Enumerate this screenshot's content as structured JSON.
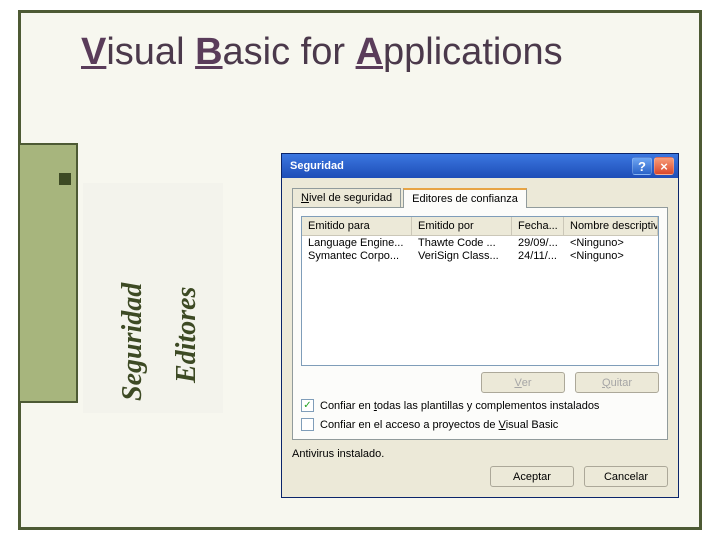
{
  "slide_title": {
    "v": "V",
    "visual_rest": "isual ",
    "b": "B",
    "basic_rest": "asic for ",
    "a": "A",
    "app_rest": "pplications"
  },
  "labels": {
    "seguridad": "Seguridad",
    "editores": "Editores"
  },
  "dialog": {
    "title": "Seguridad",
    "tabs": {
      "nivel_prefix": "N",
      "nivel_rest": "ivel de seguridad",
      "editores": "Editores de confianza"
    },
    "columns": {
      "emitido_para": "Emitido para",
      "emitido_por": "Emitido por",
      "fecha": "Fecha...",
      "nombre": "Nombre descriptivo"
    },
    "rows": [
      {
        "para": "Language Engine...",
        "por": "Thawte Code ...",
        "fecha": "29/09/...",
        "nombre": "<Ninguno>"
      },
      {
        "para": "Symantec Corpo...",
        "por": "VeriSign Class...",
        "fecha": "24/11/...",
        "nombre": "<Ninguno>"
      }
    ],
    "buttons": {
      "ver_v": "V",
      "ver_rest": "er",
      "quitar_q": "Q",
      "quitar_rest": "uitar",
      "aceptar": "Aceptar",
      "cancelar": "Cancelar"
    },
    "checks": {
      "c1_pre": "Confiar en ",
      "c1_ul": "t",
      "c1_post": "odas las plantillas y complementos instalados",
      "c2_pre": "Confiar en el acceso a proyectos de ",
      "c2_ul": "V",
      "c2_post": "isual Basic"
    },
    "status": "Antivirus instalado."
  }
}
